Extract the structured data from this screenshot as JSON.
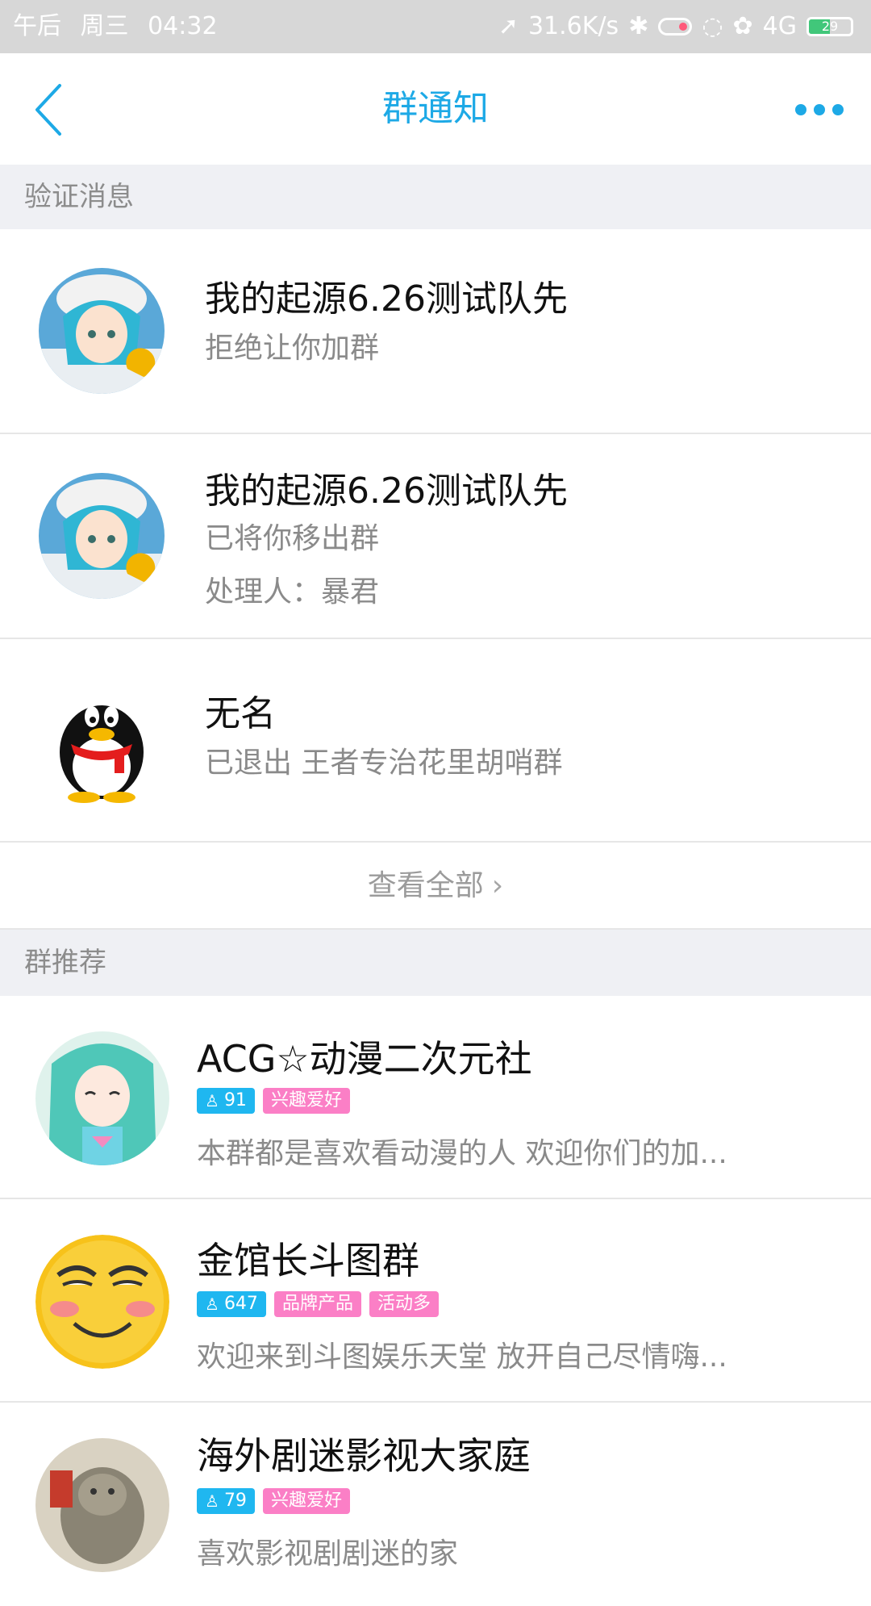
{
  "status": {
    "time_prefix": "午后",
    "weekday": "周三",
    "time": "04:32",
    "speed": "31.6K/s",
    "network": "4G",
    "battery": "29"
  },
  "nav": {
    "title": "群通知"
  },
  "sections": {
    "verify": "验证消息",
    "recommend": "群推荐"
  },
  "notices": [
    {
      "title": "我的起源6.26测试队先",
      "line1": "拒绝让你加群",
      "line2": ""
    },
    {
      "title": "我的起源6.26测试队先",
      "line1": "已将你移出群",
      "line2": "处理人：暴君"
    },
    {
      "title": "无名",
      "line1": "已退出 王者专治花里胡哨群",
      "line2": ""
    }
  ],
  "view_all": "查看全部",
  "recommendations": [
    {
      "name": "ACG☆动漫二次元社",
      "members": "91",
      "tags": [
        "兴趣爱好"
      ],
      "desc": "本群都是喜欢看动漫的人 欢迎你们的加..."
    },
    {
      "name": "金馆长斗图群",
      "members": "647",
      "tags": [
        "品牌产品",
        "活动多"
      ],
      "desc": "欢迎来到斗图娱乐天堂 放开自己尽情嗨..."
    },
    {
      "name": "海外剧迷影视大家庭",
      "members": "79",
      "tags": [
        "兴趣爱好"
      ],
      "desc": "喜欢影视剧剧迷的家"
    }
  ],
  "colors": {
    "accent": "#1da9e6",
    "tag_count": "#1fb7f0",
    "tag_pink": "#fb7fc6",
    "section_bg": "#eff0f4"
  }
}
